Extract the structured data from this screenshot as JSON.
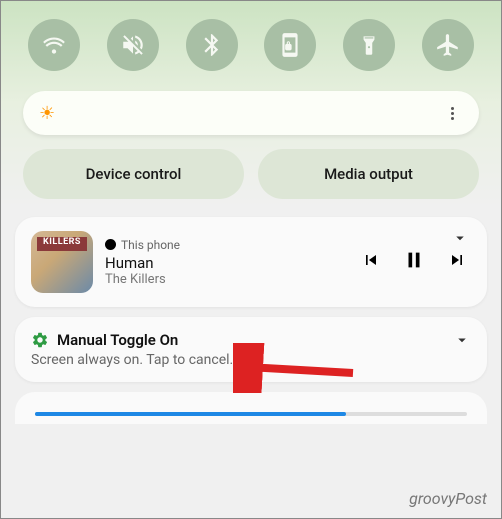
{
  "quick_toggles": [
    {
      "name": "wifi",
      "label": "Wi-Fi"
    },
    {
      "name": "mute",
      "label": "Mute"
    },
    {
      "name": "bluetooth",
      "label": "Bluetooth"
    },
    {
      "name": "rotation-lock",
      "label": "Auto rotate"
    },
    {
      "name": "flashlight",
      "label": "Flashlight"
    },
    {
      "name": "airplane",
      "label": "Airplane mode"
    }
  ],
  "pills": {
    "device_control": "Device control",
    "media_output": "Media output"
  },
  "media": {
    "source": "This phone",
    "title": "Human",
    "artist": "The Killers",
    "album_text": "KILLERS"
  },
  "notification": {
    "title": "Manual Toggle On",
    "body": "Screen always on. Tap to cancel."
  },
  "watermark": "groovyPost"
}
